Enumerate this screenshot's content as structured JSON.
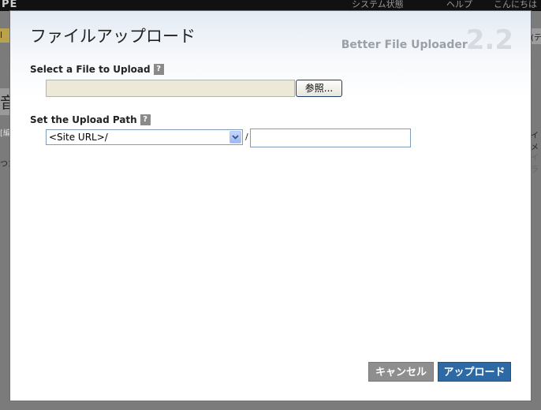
{
  "background": {
    "logo": "PE",
    "menu_1": "システム状態",
    "menu_2": "ヘルプ",
    "menu_3": "こんにちは",
    "left_tab": "l",
    "left_heading": "音",
    "left_small_1": "[編",
    "left_small_2": "つた",
    "right_tab": "(テ",
    "right_text_1": "イメ",
    "right_text_2": "イラ"
  },
  "dialog": {
    "title": "ファイルアップロード",
    "brand_name": "Better File Uploader",
    "brand_version": "2.2",
    "file_label": "Select a File to Upload",
    "help_glyph": "?",
    "file_path_value": "",
    "browse_label": "参照...",
    "path_label": "Set the Upload Path",
    "path_select_value": "<Site URL>/",
    "path_separator": "/",
    "path_input_value": "",
    "cancel_label": "キャンセル",
    "upload_label": "アップロード"
  },
  "colors": {
    "upload_button": "#2d6aa4",
    "cancel_button": "#8e8e8e",
    "overlay": "#7b7b7b"
  }
}
